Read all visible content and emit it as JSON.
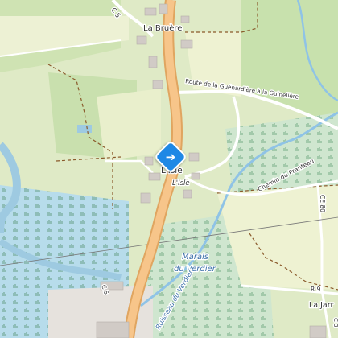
{
  "map": {
    "labels": {
      "hamlet_top": "La Bruère",
      "road_c5": "C 5",
      "route_guenardiere": "Route de la Guénardière à la Guinelière",
      "place_lisle": "L'Isle",
      "place_lisle_italic": "L'Isle",
      "chemin_pranteau": "Chemin du Pranteau",
      "road_ce80": "CE 80",
      "marais_1": "Marais",
      "marais_2": "du Verdier",
      "ruisseau": "Ruisseau du Verdier",
      "road_r9": "R 9",
      "place_la_jarrie": "La Jarr",
      "road_c5_bottom": "C 5"
    },
    "marker_icon": "turn-right-direction-icon",
    "colors": {
      "main_road": "#f7c58a",
      "main_road_casing": "#e0a560",
      "water": "#9ecae1",
      "forest": "#b6d8a2",
      "meadow": "#e9efcc",
      "wetland": "#bfe0d6",
      "building": "#d1cbc6",
      "boundary": "#8a5a2b",
      "marker": "#1e88e5"
    }
  }
}
